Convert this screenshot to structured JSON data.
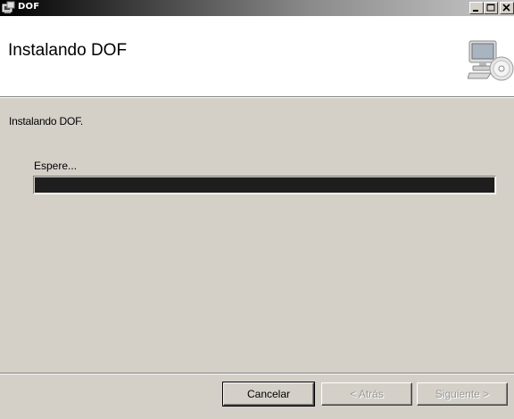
{
  "window": {
    "title": "DOF",
    "controls": {
      "minimize_icon": "minimize-icon",
      "maximize_icon": "maximize-icon",
      "close_icon": "close-icon"
    }
  },
  "header": {
    "title": "Instalando DOF",
    "icon": "computer-cd-icon"
  },
  "main": {
    "status_text": "Instalando DOF.",
    "wait_label": "Espere...",
    "progress_fraction": 1.0
  },
  "footer": {
    "cancel_label": "Cancelar",
    "back_label": "< Atrás",
    "next_label": "Siguiente >"
  },
  "colors": {
    "progress_fill": "#1e1e1e",
    "face": "#d4d0c8",
    "banner": "#ffffff"
  }
}
